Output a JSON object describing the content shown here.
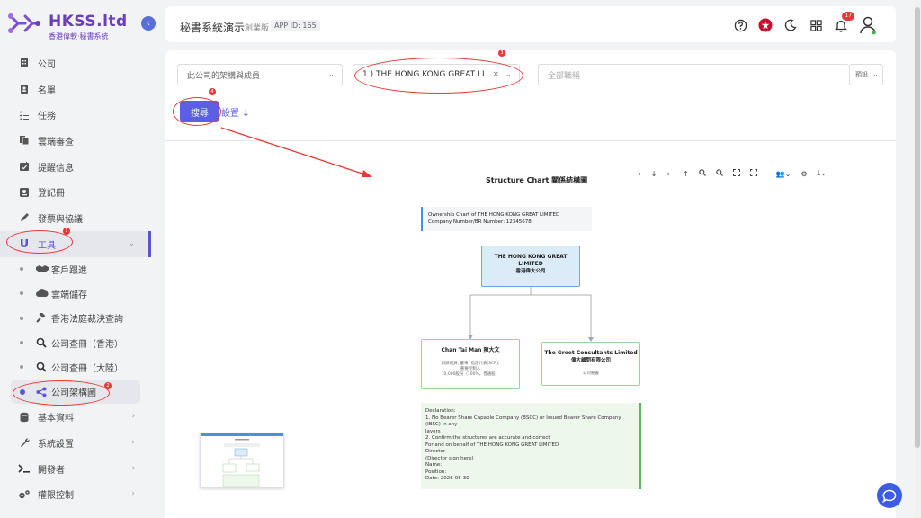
{
  "sidebar": {
    "logo": {
      "title": "HKSS.ltd",
      "subtitle": "香港偉軟‧秘書系統"
    },
    "items": [
      {
        "label": "公司",
        "icon": "building-icon"
      },
      {
        "label": "名單",
        "icon": "contact-book-icon"
      },
      {
        "label": "任務",
        "icon": "task-list-icon"
      },
      {
        "label": "雲端審查",
        "icon": "copy-icon"
      },
      {
        "label": "提醒信息",
        "icon": "calendar-check-icon"
      },
      {
        "label": "登記冊",
        "icon": "register-icon"
      },
      {
        "label": "發票與協議",
        "icon": "pen-icon"
      },
      {
        "label": "工具",
        "icon": "magnet-icon",
        "badge": "1"
      }
    ],
    "sub_items": [
      {
        "label": "客戶跟進",
        "icon": "handshake-icon"
      },
      {
        "label": "雲端儲存",
        "icon": "cloud-icon"
      },
      {
        "label": "香港法庭裁決查詢",
        "icon": "gavel-icon"
      },
      {
        "label": "公司查冊（香港）",
        "icon": "search-icon"
      },
      {
        "label": "公司查冊（大陸）",
        "icon": "search-icon"
      },
      {
        "label": "公司架構圖",
        "icon": "structure-icon",
        "badge": "2"
      }
    ],
    "bottom_items": [
      {
        "label": "基本資料",
        "icon": "database-icon"
      },
      {
        "label": "系統設置",
        "icon": "wrench-icon"
      },
      {
        "label": "開發者",
        "icon": "terminal-icon"
      },
      {
        "label": "權限控制",
        "icon": "gears-icon"
      }
    ]
  },
  "header": {
    "title": "秘書系統演示",
    "edition": "創業版",
    "app_id": "APP ID: 165",
    "notification_count": "17"
  },
  "form": {
    "structure_select": "此公司的架構與成員",
    "company_select": "1 ) THE HONG KONG GREAT LI...",
    "company_badge": "3",
    "position_placeholder": "全部職稱",
    "preset_label": "預設",
    "search_button": "搜尋",
    "search_badge": "4",
    "settings_link": "設置"
  },
  "chart": {
    "title": "Structure Chart 關係結構圖",
    "ownership_line1": "Ownership Chart of THE HONG KONG GREAT LIMITED",
    "ownership_line2": "Company Number/BR Number: 12345678",
    "root_name_en": "THE HONG KONG GREAT LIMITED",
    "root_name_zh": "香港偉大公司",
    "person_name": "Chan Tai Man 陳大文",
    "person_role1": "創辦成員, 董事, 指定代表(SCR),",
    "person_role2": "重要控制人",
    "person_shares": "10,000股份（100%，普通股）",
    "company_name_en": "The Greet Consultants Limited",
    "company_name_zh": "偉大顧問有限公司",
    "company_role": "公司秘書",
    "declaration": [
      "Declaration:",
      "1. No Bearer Share Capable Company (BSCC) or Issued Bearer Share Company (IBSC) in any",
      "layers",
      "2. Confirm the structures are accurate and correct",
      "For and on behalf of THE HONG KONG GREAT LIMITED",
      "Director",
      "(Director sign here)",
      "Name:",
      "Position:",
      "Date: 2026-05-30"
    ]
  },
  "colors": {
    "accent": "#5b5fe6",
    "annotation_red": "#e53935",
    "root_fill": "#dcebf8",
    "declaration_border": "#5cb85c"
  }
}
